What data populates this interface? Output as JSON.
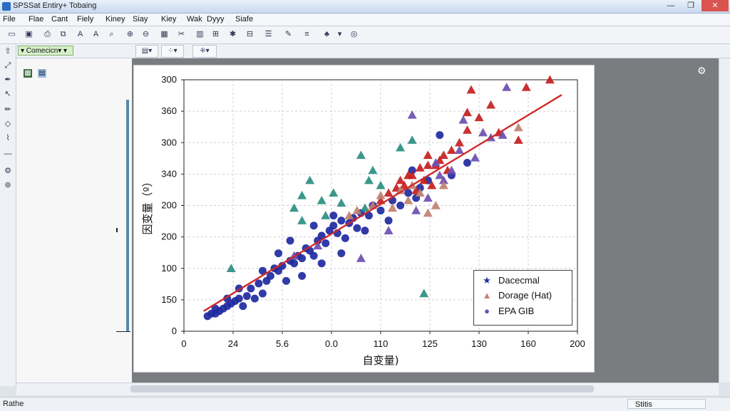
{
  "window": {
    "title": "SPSSat Entiry+ Tobaing",
    "min": "—",
    "max": "❐",
    "close": "✕"
  },
  "menu": [
    "File",
    "Flae",
    "Cant",
    "Fiely",
    "Kiney",
    "Siay",
    "Kiey",
    "Wak",
    "Dyyy",
    "Siafe"
  ],
  "toolbar": {
    "var_select": "▾ Comecicn▾ ▾"
  },
  "status": {
    "left": "Rathe",
    "right": "Stitis"
  },
  "icons": {
    "gear": "gear-icon"
  },
  "colors": {
    "blue": "#1f2aa0",
    "red": "#c41e1e",
    "teal": "#2a8f80",
    "purple": "#6d4fb0",
    "tan": "#c08070",
    "line": "#d02828"
  },
  "chart_data": {
    "type": "scatter",
    "xlabel": "自变量)",
    "ylabel": "因变量（º）",
    "x_ticks": [
      "0",
      "24",
      "5.6",
      "0.0",
      "110",
      "125",
      "130",
      "160",
      "200"
    ],
    "y_ticks": [
      "0",
      "150",
      "100",
      "200",
      "200",
      "340",
      "300",
      "360",
      "300"
    ],
    "legend": [
      {
        "label": "Dacecmal",
        "symbol": "star",
        "color": "#1f2aa0"
      },
      {
        "label": "Dorage (Hat)",
        "symbol": "triangle",
        "color": "#c08070"
      },
      {
        "label": "EPA GIB",
        "symbol": "circle",
        "color": "#6d4fb0"
      }
    ],
    "grid": true,
    "legend_position": "bottom-right",
    "trend_line": {
      "from": [
        0.05,
        0.08
      ],
      "to": [
        0.96,
        0.94
      ]
    },
    "series": [
      {
        "name": "Dacecmal",
        "marker": "circle",
        "color": "#1f2aa0",
        "points": [
          [
            0.06,
            0.06
          ],
          [
            0.07,
            0.07
          ],
          [
            0.08,
            0.07
          ],
          [
            0.09,
            0.08
          ],
          [
            0.1,
            0.09
          ],
          [
            0.11,
            0.1
          ],
          [
            0.12,
            0.11
          ],
          [
            0.13,
            0.12
          ],
          [
            0.14,
            0.13
          ],
          [
            0.16,
            0.14
          ],
          [
            0.17,
            0.17
          ],
          [
            0.19,
            0.19
          ],
          [
            0.2,
            0.15
          ],
          [
            0.21,
            0.2
          ],
          [
            0.22,
            0.22
          ],
          [
            0.23,
            0.25
          ],
          [
            0.24,
            0.24
          ],
          [
            0.25,
            0.26
          ],
          [
            0.27,
            0.28
          ],
          [
            0.28,
            0.27
          ],
          [
            0.29,
            0.3
          ],
          [
            0.3,
            0.29
          ],
          [
            0.31,
            0.33
          ],
          [
            0.32,
            0.32
          ],
          [
            0.33,
            0.3
          ],
          [
            0.34,
            0.36
          ],
          [
            0.35,
            0.38
          ],
          [
            0.36,
            0.35
          ],
          [
            0.37,
            0.4
          ],
          [
            0.38,
            0.42
          ],
          [
            0.39,
            0.39
          ],
          [
            0.4,
            0.44
          ],
          [
            0.41,
            0.37
          ],
          [
            0.42,
            0.43
          ],
          [
            0.43,
            0.45
          ],
          [
            0.44,
            0.41
          ],
          [
            0.45,
            0.47
          ],
          [
            0.46,
            0.4
          ],
          [
            0.47,
            0.46
          ],
          [
            0.48,
            0.5
          ],
          [
            0.5,
            0.48
          ],
          [
            0.52,
            0.44
          ],
          [
            0.53,
            0.52
          ],
          [
            0.55,
            0.5
          ],
          [
            0.57,
            0.55
          ],
          [
            0.59,
            0.53
          ],
          [
            0.6,
            0.57
          ],
          [
            0.62,
            0.6
          ],
          [
            0.2,
            0.24
          ],
          [
            0.15,
            0.1
          ],
          [
            0.18,
            0.13
          ],
          [
            0.26,
            0.2
          ],
          [
            0.3,
            0.22
          ],
          [
            0.35,
            0.27
          ],
          [
            0.4,
            0.31
          ],
          [
            0.27,
            0.36
          ],
          [
            0.33,
            0.42
          ],
          [
            0.38,
            0.46
          ],
          [
            0.58,
            0.64
          ],
          [
            0.65,
            0.78
          ],
          [
            0.68,
            0.62
          ],
          [
            0.72,
            0.67
          ],
          [
            0.24,
            0.31
          ],
          [
            0.14,
            0.17
          ],
          [
            0.11,
            0.13
          ],
          [
            0.08,
            0.09
          ]
        ]
      },
      {
        "name": "Red",
        "marker": "triangle",
        "color": "#c41e1e",
        "points": [
          [
            0.5,
            0.52
          ],
          [
            0.52,
            0.55
          ],
          [
            0.54,
            0.57
          ],
          [
            0.55,
            0.6
          ],
          [
            0.56,
            0.58
          ],
          [
            0.58,
            0.62
          ],
          [
            0.59,
            0.56
          ],
          [
            0.6,
            0.65
          ],
          [
            0.61,
            0.6
          ],
          [
            0.62,
            0.7
          ],
          [
            0.63,
            0.58
          ],
          [
            0.64,
            0.66
          ],
          [
            0.65,
            0.68
          ],
          [
            0.66,
            0.7
          ],
          [
            0.67,
            0.64
          ],
          [
            0.68,
            0.72
          ],
          [
            0.7,
            0.75
          ],
          [
            0.72,
            0.8
          ],
          [
            0.75,
            0.85
          ],
          [
            0.78,
            0.9
          ],
          [
            0.8,
            0.79
          ],
          [
            0.72,
            0.87
          ],
          [
            0.73,
            0.96
          ],
          [
            0.87,
            0.97
          ],
          [
            0.85,
            0.76
          ],
          [
            0.93,
            1.0
          ],
          [
            0.62,
            0.66
          ],
          [
            0.57,
            0.62
          ]
        ]
      },
      {
        "name": "Purple",
        "marker": "triangle",
        "color": "#6d4fb0",
        "points": [
          [
            0.58,
            0.86
          ],
          [
            0.7,
            0.72
          ],
          [
            0.74,
            0.69
          ],
          [
            0.76,
            0.79
          ],
          [
            0.82,
            0.97
          ],
          [
            0.78,
            0.77
          ],
          [
            0.68,
            0.64
          ],
          [
            0.64,
            0.67
          ],
          [
            0.66,
            0.6
          ],
          [
            0.62,
            0.53
          ],
          [
            0.71,
            0.84
          ],
          [
            0.28,
            0.3
          ],
          [
            0.34,
            0.34
          ],
          [
            0.45,
            0.29
          ],
          [
            0.52,
            0.4
          ],
          [
            0.59,
            0.48
          ],
          [
            0.65,
            0.62
          ],
          [
            0.81,
            0.78
          ]
        ]
      },
      {
        "name": "Teal",
        "marker": "triangle",
        "color": "#2a8f80",
        "points": [
          [
            0.32,
            0.6
          ],
          [
            0.3,
            0.54
          ],
          [
            0.35,
            0.52
          ],
          [
            0.38,
            0.55
          ],
          [
            0.45,
            0.7
          ],
          [
            0.48,
            0.64
          ],
          [
            0.5,
            0.58
          ],
          [
            0.55,
            0.73
          ],
          [
            0.58,
            0.76
          ],
          [
            0.61,
            0.15
          ],
          [
            0.46,
            0.49
          ],
          [
            0.4,
            0.51
          ],
          [
            0.3,
            0.44
          ],
          [
            0.28,
            0.49
          ],
          [
            0.12,
            0.25
          ],
          [
            0.36,
            0.46
          ],
          [
            0.47,
            0.6
          ]
        ]
      },
      {
        "name": "Tan",
        "marker": "triangle",
        "color": "#c08070",
        "points": [
          [
            0.48,
            0.5
          ],
          [
            0.5,
            0.54
          ],
          [
            0.53,
            0.49
          ],
          [
            0.55,
            0.56
          ],
          [
            0.57,
            0.52
          ],
          [
            0.6,
            0.55
          ],
          [
            0.62,
            0.47
          ],
          [
            0.85,
            0.81
          ],
          [
            0.66,
            0.58
          ],
          [
            0.42,
            0.46
          ],
          [
            0.44,
            0.48
          ],
          [
            0.64,
            0.5
          ],
          [
            0.58,
            0.58
          ]
        ]
      }
    ]
  }
}
